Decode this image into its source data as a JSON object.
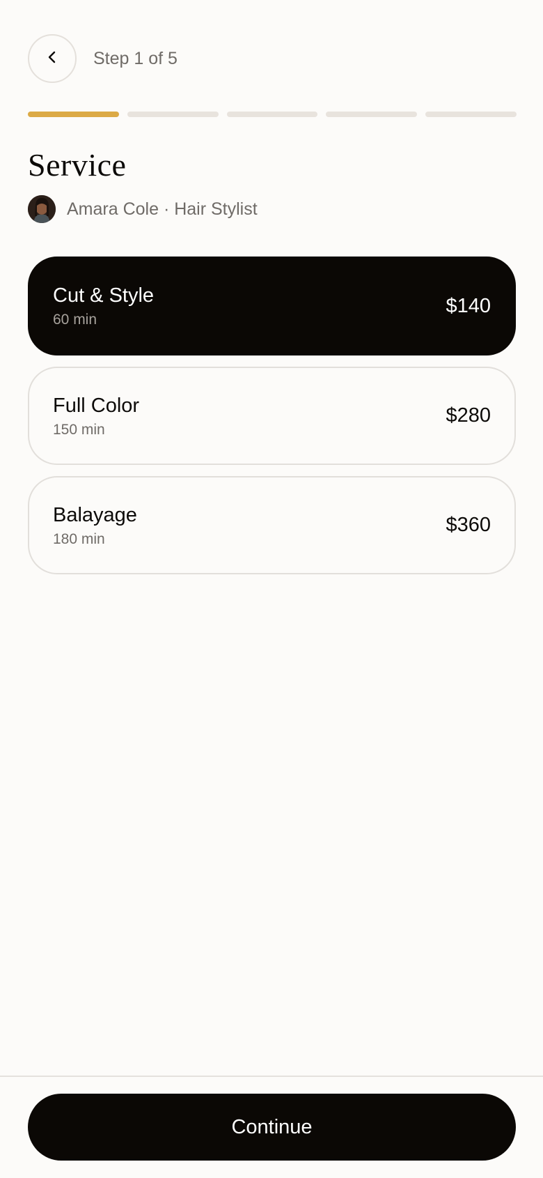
{
  "header": {
    "step_label": "Step 1 of 5"
  },
  "progress": {
    "current_step": 1,
    "total_steps": 5,
    "active_color": "#dcaa46"
  },
  "page": {
    "title": "Service"
  },
  "professional": {
    "name_role": "Amara Cole · Hair Stylist"
  },
  "services": [
    {
      "name": "Cut & Style",
      "duration": "60 min",
      "price": "$140",
      "selected": true
    },
    {
      "name": "Full Color",
      "duration": "150 min",
      "price": "$280",
      "selected": false
    },
    {
      "name": "Balayage",
      "duration": "180 min",
      "price": "$360",
      "selected": false
    }
  ],
  "footer": {
    "continue_label": "Continue"
  },
  "icons": {
    "back": "chevron-left-icon"
  }
}
